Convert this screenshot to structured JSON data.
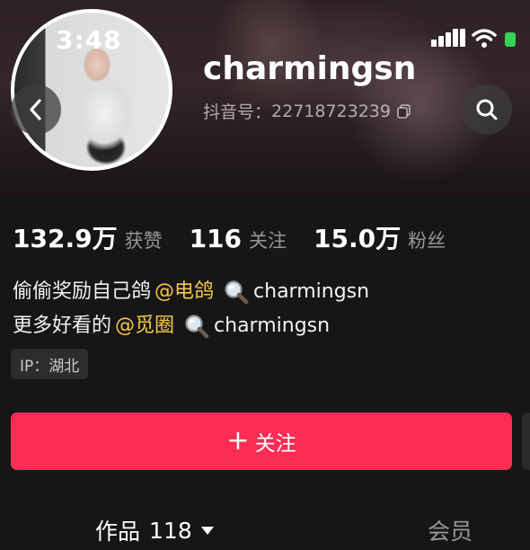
{
  "status_bar": {
    "time": "3:48"
  },
  "header": {
    "username": "charmingsn",
    "douyin_id_label": "抖音号：",
    "douyin_id_value": "22718723239"
  },
  "stats": [
    {
      "value": "132.9万",
      "label": "获赞"
    },
    {
      "value": "116",
      "label": "关注"
    },
    {
      "value": "15.0万",
      "label": "粉丝"
    }
  ],
  "bio": {
    "line1_text": "偷偷奖励自己鸽",
    "line1_mention": "@电鸽",
    "line1_search": "charmingsn",
    "line2_text": "更多好看的",
    "line2_mention": "@觅圈",
    "line2_search": "charmingsn"
  },
  "ip_tag": "IP：湖北",
  "follow_button": {
    "plus": "+",
    "label": "关注"
  },
  "tabs": {
    "works_label": "作品",
    "works_count": "118",
    "member_label": "会员"
  },
  "icons": {
    "back": "chevron-left-icon",
    "search": "search-icon",
    "copy": "copy-icon",
    "magnifier": "magnifier-icon"
  },
  "colors": {
    "follow_button": "#fc2c55",
    "mention": "#f7c84a",
    "battery": "#36d15a",
    "background": "#161616"
  }
}
